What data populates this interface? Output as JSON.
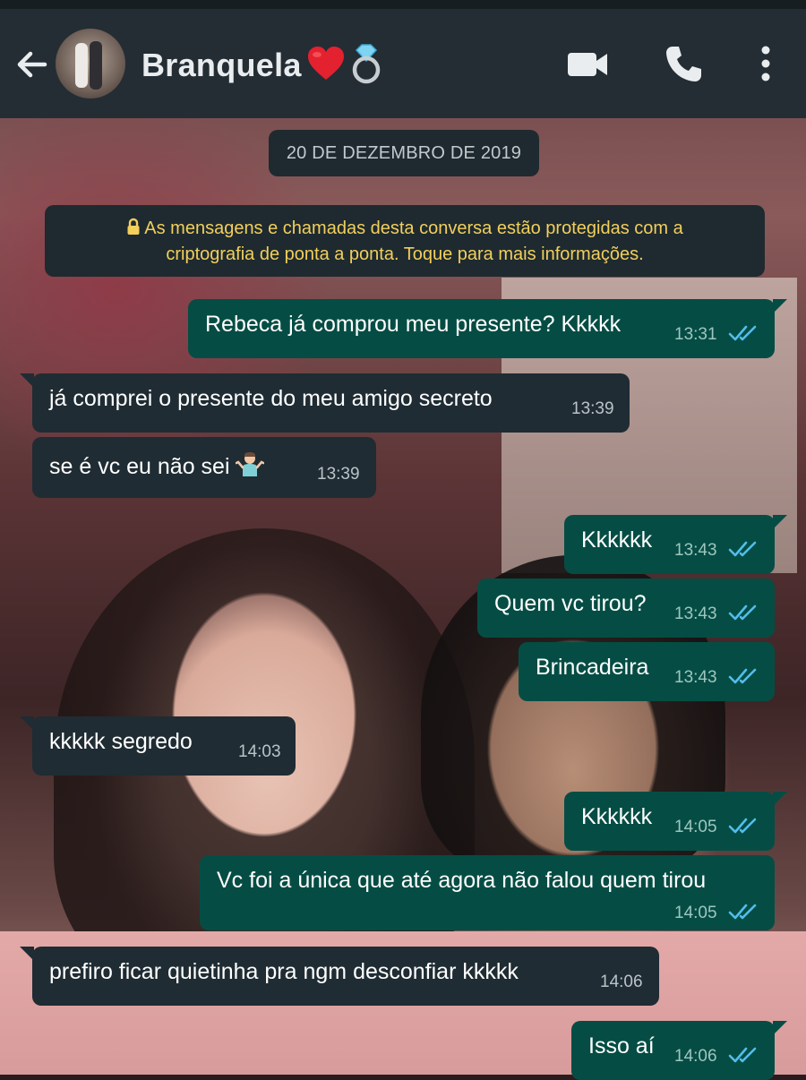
{
  "header": {
    "contact_name": "Branquela",
    "name_emojis": [
      "red-heart",
      "ring"
    ]
  },
  "chat": {
    "date_label": "20 DE DEZEMBRO DE 2019",
    "encryption_notice_line1": "As mensagens e chamadas desta conversa estão protegidas com a",
    "encryption_notice_line2": "criptografia de ponta a ponta. Toque para mais informações.",
    "messages": [
      {
        "dir": "out",
        "text": "Rebeca já comprou meu presente? Kkkkk",
        "time": "13:31",
        "status": "read"
      },
      {
        "dir": "in",
        "text": "já comprei o presente do meu amigo secreto",
        "time": "13:39"
      },
      {
        "dir": "in",
        "text": "se é vc eu não sei",
        "emoji": "person-shrugging",
        "time": "13:39"
      },
      {
        "dir": "out",
        "text": "Kkkkkk",
        "time": "13:43",
        "status": "read"
      },
      {
        "dir": "out",
        "text": "Quem vc tirou?",
        "time": "13:43",
        "status": "read"
      },
      {
        "dir": "out",
        "text": "Brincadeira",
        "time": "13:43",
        "status": "read"
      },
      {
        "dir": "in",
        "text": "kkkkk segredo",
        "time": "14:03"
      },
      {
        "dir": "out",
        "text": "Kkkkkk",
        "time": "14:05",
        "status": "read"
      },
      {
        "dir": "out",
        "text": "Vc foi a única que até agora não falou quem tirou",
        "time": "14:05",
        "status": "read"
      },
      {
        "dir": "in",
        "text": "prefiro ficar quietinha pra ngm desconfiar kkkkk",
        "time": "14:06"
      },
      {
        "dir": "out",
        "text": "Isso aí",
        "time": "14:06",
        "status": "read"
      }
    ]
  },
  "colors": {
    "header_bg": "#242d34",
    "outgoing_bubble": "#054d44",
    "incoming_bubble": "#1f2c33",
    "read_ticks": "#53bdeb",
    "encryption_text": "#f3cf5b"
  },
  "icons": [
    "back-arrow-icon",
    "video-call-icon",
    "voice-call-icon",
    "more-options-icon",
    "lock-icon",
    "double-check-icon"
  ]
}
